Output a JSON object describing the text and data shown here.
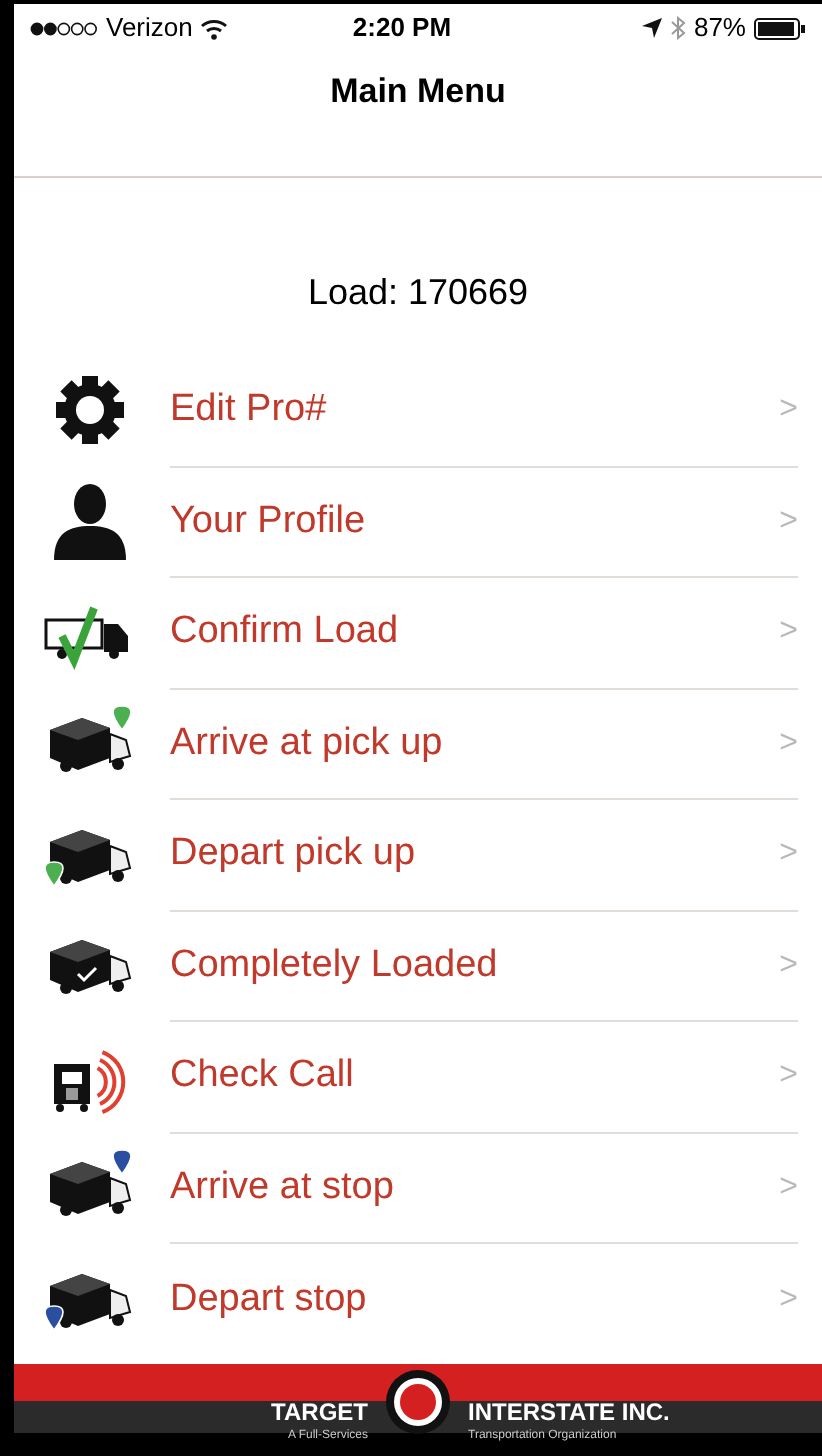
{
  "status_bar": {
    "carrier": "Verizon",
    "time": "2:20 PM",
    "battery": "87%"
  },
  "nav": {
    "title": "Main Menu"
  },
  "load": {
    "label": "Load:",
    "number": "170669"
  },
  "menu": [
    {
      "label": "Edit Pro#",
      "kind": "gear",
      "chevron": ">"
    },
    {
      "label": "Your Profile",
      "kind": "person",
      "chevron": ">"
    },
    {
      "label": "Confirm Load",
      "kind": "confirm",
      "chevron": ">"
    },
    {
      "label": "Arrive at pick up",
      "kind": "arrive-pickup",
      "chevron": ">"
    },
    {
      "label": "Depart pick up",
      "kind": "depart-pickup",
      "chevron": ">"
    },
    {
      "label": "Completely Loaded",
      "kind": "loaded",
      "chevron": ">"
    },
    {
      "label": "Check Call",
      "kind": "call",
      "chevron": ">"
    },
    {
      "label": "Arrive at stop",
      "kind": "arrive-stop",
      "chevron": ">"
    },
    {
      "label": "Depart stop",
      "kind": "depart-stop",
      "chevron": ">"
    }
  ],
  "footer": {
    "left": "TARGET",
    "right": "INTERSTATE INC.",
    "left_sub": "A Full-Services",
    "right_sub": "Transportation Organization"
  }
}
